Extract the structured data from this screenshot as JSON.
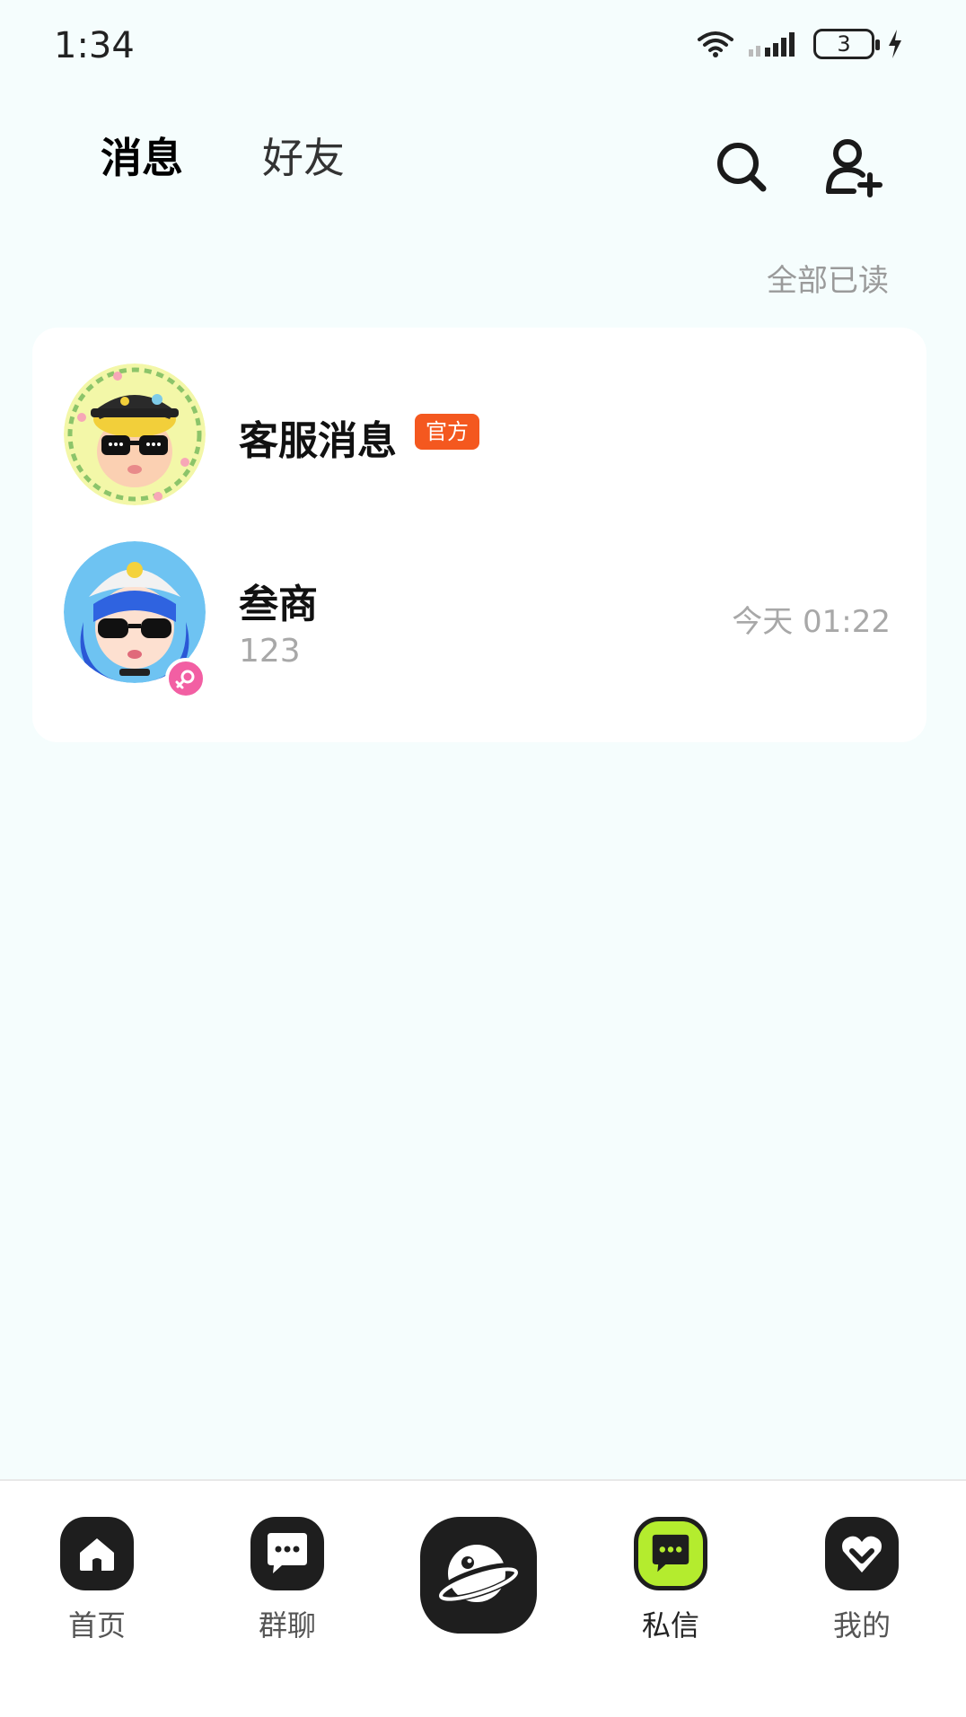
{
  "status_bar": {
    "time": "1:34",
    "battery": "3"
  },
  "header": {
    "tabs": [
      {
        "label": "消息",
        "active": true
      },
      {
        "label": "好友",
        "active": false
      }
    ],
    "accent_color": "#c6f24a"
  },
  "mark_all_read": "全部已读",
  "messages": [
    {
      "name": "客服消息",
      "badge": "官方",
      "badge_color": "#f4581f",
      "avatar": "avatar-boy-cap-sunglasses"
    },
    {
      "name": "叁商",
      "preview": "123",
      "time": "今天 01:22",
      "avatar": "avatar-girl-blue-hair",
      "gender": "female"
    }
  ],
  "bottom_nav": {
    "items": [
      {
        "label": "首页",
        "icon": "home-icon"
      },
      {
        "label": "群聊",
        "icon": "chat-bubble-icon"
      },
      {
        "label": "",
        "icon": "planet-icon"
      },
      {
        "label": "私信",
        "icon": "chat-bubble-icon",
        "active": true
      },
      {
        "label": "我的",
        "icon": "heart-check-icon"
      }
    ],
    "active_color": "#b4ec2e"
  }
}
